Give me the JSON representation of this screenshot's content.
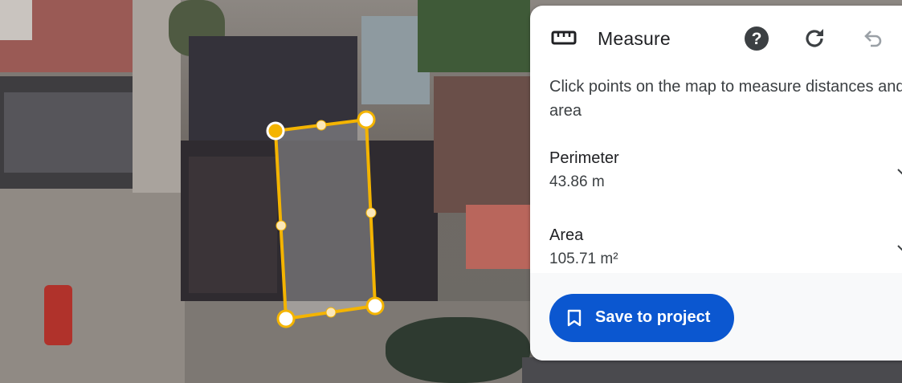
{
  "panel": {
    "title": "Measure",
    "title_icon": "ruler-icon",
    "help_icon": "help-icon",
    "refresh_icon": "refresh-icon",
    "undo_icon": "undo-icon",
    "instructions": "Click points on the map to measure distances and area",
    "perimeter": {
      "label": "Perimeter",
      "value": "43.86 m"
    },
    "area": {
      "label": "Area",
      "value": "105.71 m²"
    },
    "save_button": {
      "label": "Save to project",
      "icon": "bookmark-icon"
    }
  },
  "colors": {
    "accent": "#0b57d0",
    "measure_line": "#f4b400",
    "panel_bg": "#ffffff"
  }
}
